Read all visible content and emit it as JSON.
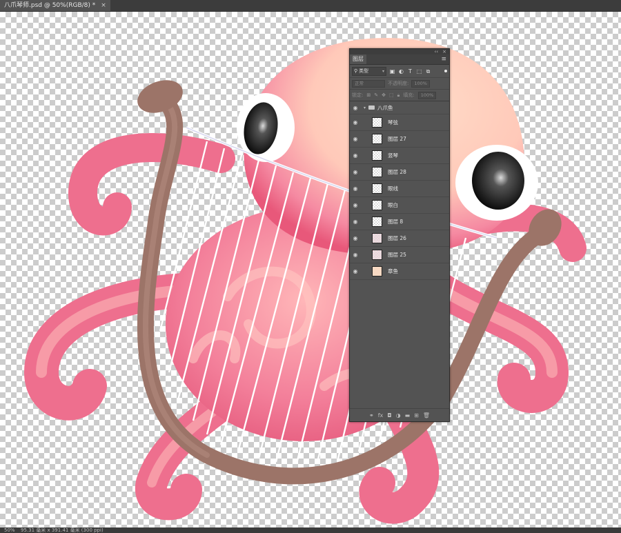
{
  "document": {
    "tab_title": "八爪琴师.psd @ 50%(RGB/8) *",
    "close": "×"
  },
  "status": {
    "zoom": "50%",
    "dimensions": "95.31 毫米 x 391.41 毫米 (300 ppi)"
  },
  "panel": {
    "collapse": "‹‹",
    "close": "×",
    "tab": "图层",
    "menu_icon": "hamburger-menu-icon",
    "filter_kind": "类型",
    "blend_mode": "正常",
    "opacity_label": "不透明度:",
    "opacity_value": "100%",
    "lock_label": "锁定:",
    "fill_label": "填充:",
    "fill_value": "100%",
    "group": {
      "name": "八爪鱼",
      "expanded": true
    },
    "layers": [
      {
        "name": "琴弦",
        "thumb": "transparent"
      },
      {
        "name": "图层 27",
        "thumb": "transparent"
      },
      {
        "name": "竖琴",
        "thumb": "transparent"
      },
      {
        "name": "图层 28",
        "thumb": "transparent"
      },
      {
        "name": "眼线",
        "thumb": "transparent"
      },
      {
        "name": "眼白",
        "thumb": "transparent"
      },
      {
        "name": "图层 8",
        "thumb": "transparent"
      },
      {
        "name": "图层 26",
        "thumb": "pink"
      },
      {
        "name": "图层 25",
        "thumb": "pink"
      },
      {
        "name": "章鱼",
        "thumb": "peach"
      }
    ],
    "bottom_icons": [
      "link-icon",
      "fx-icon",
      "mask-icon",
      "adjustment-icon",
      "folder-icon",
      "new-layer-icon",
      "trash-icon"
    ]
  },
  "colors": {
    "ps_bg": "#535353",
    "panel_bg": "#535353",
    "octopus_pink": "#ee6a8a",
    "octopus_light": "#ffd8c4",
    "harp_brown": "#9c7468",
    "string": "#ffffff"
  }
}
